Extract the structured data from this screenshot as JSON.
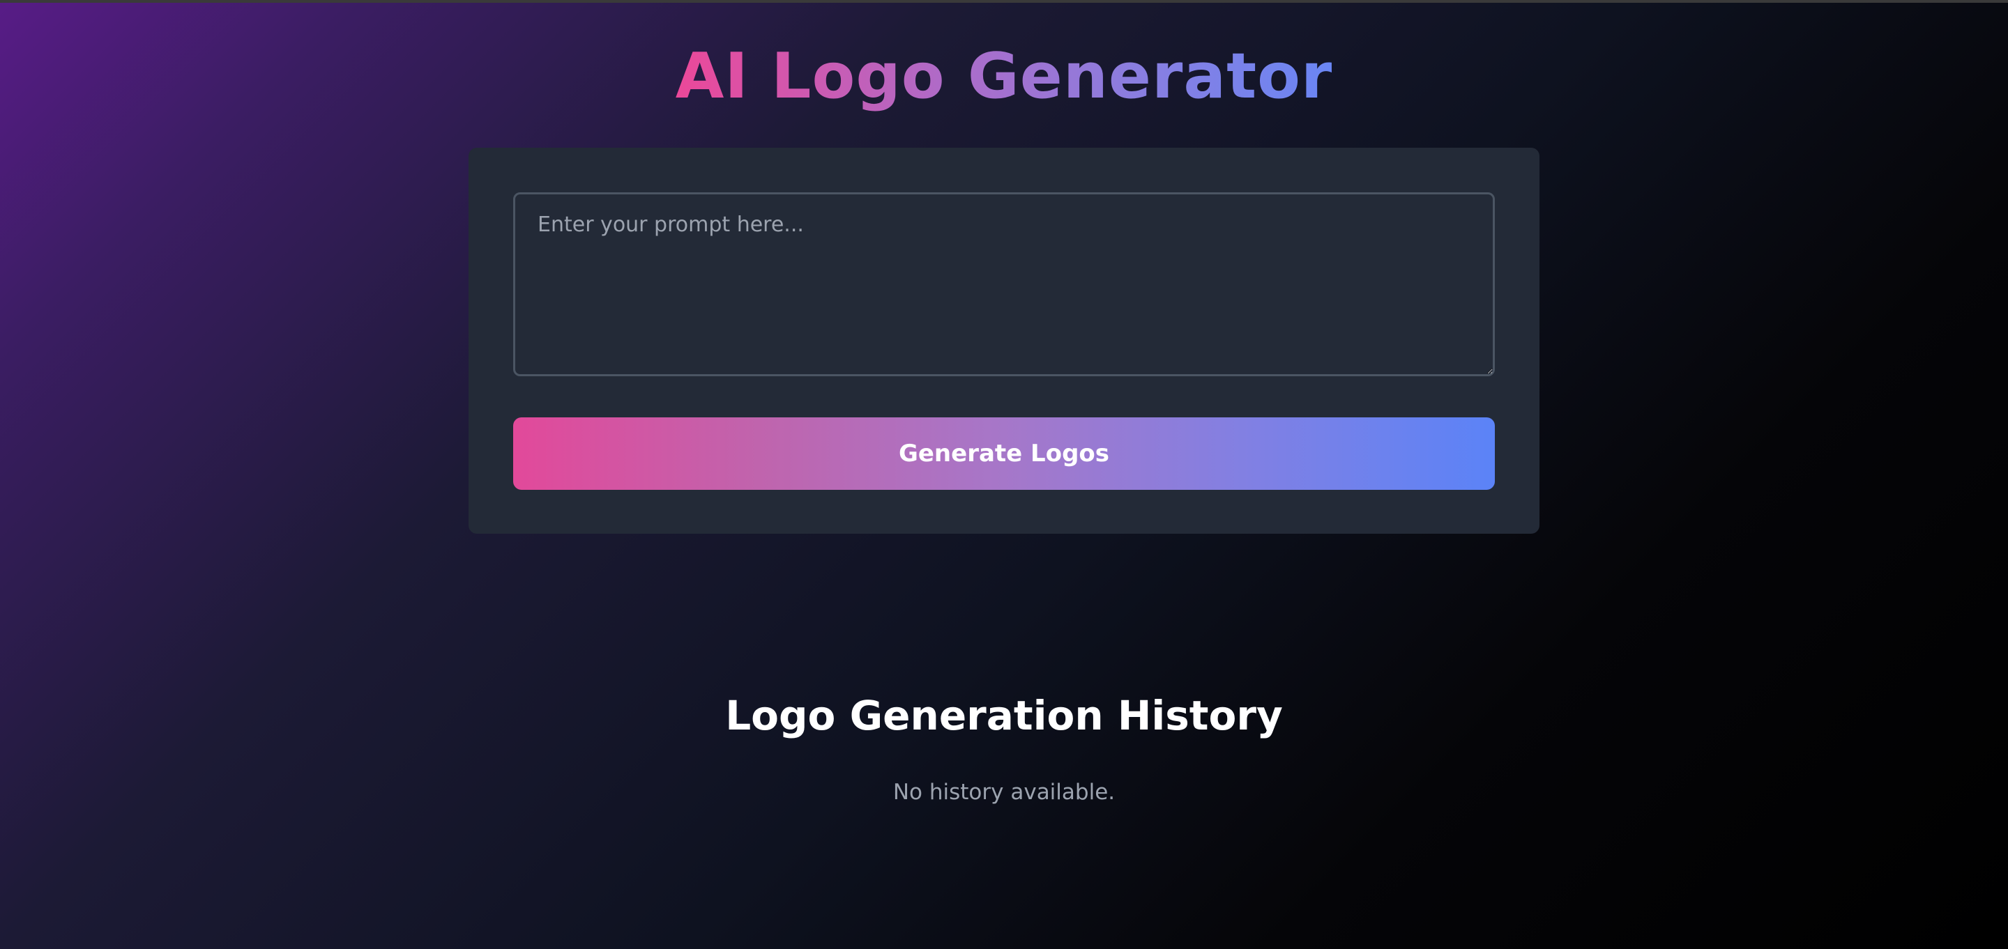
{
  "header": {
    "title": "AI Logo Generator"
  },
  "generator": {
    "prompt_value": "",
    "prompt_placeholder": "Enter your prompt here...",
    "generate_label": "Generate Logos"
  },
  "history": {
    "title": "Logo Generation History",
    "empty_text": "No history available."
  },
  "colors": {
    "title_gradient_start": "#ec4899",
    "title_gradient_end": "#6a86f4",
    "button_gradient_start": "#e2499a",
    "button_gradient_end": "#5b83f7",
    "card_background": "#232a37",
    "page_background_corner": "#581c87"
  }
}
